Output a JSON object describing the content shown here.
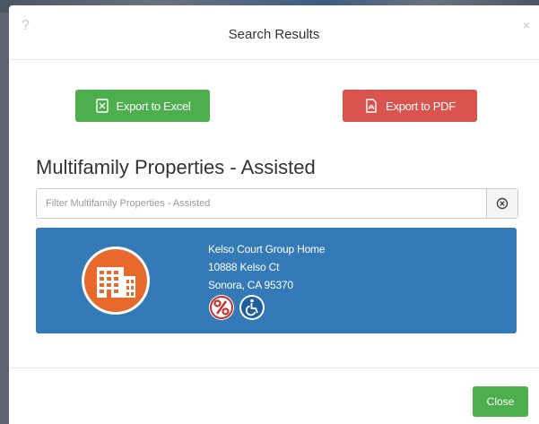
{
  "modal": {
    "help_icon": "?",
    "title": "Search Results",
    "close_icon": "×"
  },
  "export": {
    "excel_label": "Export to Excel",
    "pdf_label": "Export to PDF",
    "excel_color": "#4cae4c",
    "pdf_color": "#d9534f"
  },
  "section": {
    "title": "Multifamily Properties - Assisted"
  },
  "filter": {
    "placeholder": "Filter Multifamily Properties - Assisted",
    "value": "",
    "clear_icon": "circle-x-icon"
  },
  "results": [
    {
      "name": "Kelso Court Group Home",
      "address": "10888 Kelso Ct",
      "city_line": "Sonora, CA 95370",
      "icon": "apartment-building-icon",
      "badges": [
        "percent-icon",
        "wheelchair-accessible-icon"
      ],
      "card_color": "#337ab7",
      "badge_color": "#e8692c"
    }
  ],
  "footer": {
    "close_label": "Close"
  }
}
